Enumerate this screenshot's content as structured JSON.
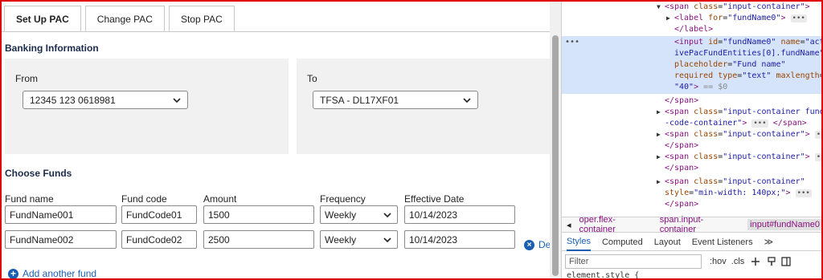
{
  "tabs": [
    {
      "label": "Set Up PAC",
      "active": true
    },
    {
      "label": "Change PAC",
      "active": false
    },
    {
      "label": "Stop PAC",
      "active": false
    }
  ],
  "banking": {
    "title": "Banking Information",
    "from": {
      "label": "From",
      "value": "12345 123 0618981"
    },
    "to": {
      "label": "To",
      "value": "TFSA - DL17XF01"
    }
  },
  "funds": {
    "title": "Choose Funds",
    "headers": [
      "Fund name",
      "Fund code",
      "Amount",
      "Frequency",
      "Effective Date"
    ],
    "rows": [
      {
        "name": "FundName001",
        "code": "FundCode01",
        "amount": "1500",
        "frequency": "Weekly",
        "date": "10/14/2023"
      },
      {
        "name": "FundName002",
        "code": "FundCode02",
        "amount": "2500",
        "frequency": "Weekly",
        "date": "10/14/2023"
      }
    ],
    "delete_label": "Del",
    "add_label": "Add another fund"
  },
  "devtools": {
    "breadcrumbs": [
      "◂",
      "oper.flex-container",
      "span.input-container",
      "input#fundName0"
    ],
    "style_tabs": [
      "Styles",
      "Computed",
      "Layout",
      "Event Listeners",
      "≫"
    ],
    "filter_placeholder": "Filter",
    "hov": ":hov",
    "cls": ".cls",
    "element_style": "element.style {"
  },
  "colors": {
    "accent": "#1a5fb4",
    "frame": "#e00000",
    "panel": "#f1f1f1",
    "selected": "#d6e4fb"
  }
}
